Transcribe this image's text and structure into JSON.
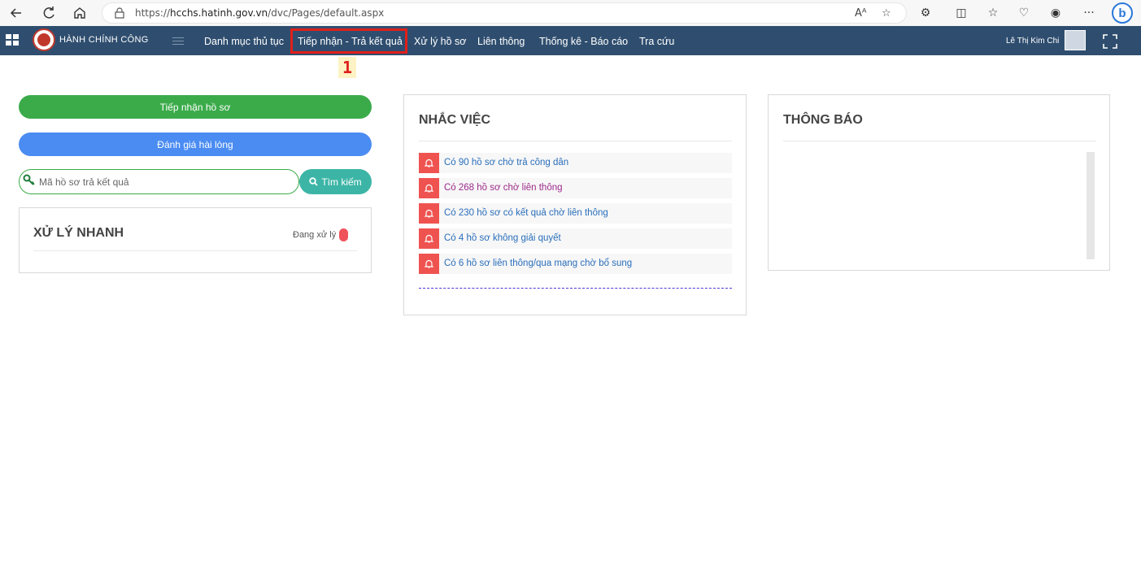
{
  "browser": {
    "url_prefix": "https://",
    "url_domain": "hcchs.hatinh.gov.vn",
    "url_path": "/dvc/Pages/default.aspx",
    "read_aloud_icon": "Aᴬ",
    "more_label": "···"
  },
  "header": {
    "brand": "HÀNH CHÍNH CÔNG",
    "menu": [
      {
        "label": "Danh mục thủ tục"
      },
      {
        "label": "Tiếp nhận - Trả kết quả"
      },
      {
        "label": "Xử lý hồ sơ"
      },
      {
        "label": "Liên thông"
      },
      {
        "label": "Thống kê - Báo cáo"
      },
      {
        "label": "Tra cứu"
      }
    ],
    "user_name": "Lê Thị Kim Chi",
    "highlight_color": "#e0201b"
  },
  "annotation": {
    "step": "1"
  },
  "left": {
    "receive_button": "Tiếp nhận hồ sơ",
    "rating_button": "Đánh giá hài lòng",
    "search_placeholder": "Mã hồ sơ trả kết quả",
    "search_button": "Tìm kiếm",
    "quick_title": "XỬ LÝ NHANH",
    "quick_status": "Đang xử lý"
  },
  "remind": {
    "title": "NHẮC VIỆC",
    "items": [
      {
        "text": "Có 90 hồ sơ chờ trả công dân"
      },
      {
        "text": "Có 268 hồ sơ chờ liên thông"
      },
      {
        "text": "Có 230 hồ sơ có kết quả chờ liên thông"
      },
      {
        "text": "Có 4 hồ sơ không giải quyết"
      },
      {
        "text": "Có 6 hồ sơ liên thông/qua mạng chờ bổ sung"
      }
    ]
  },
  "notice": {
    "title": "THÔNG BÁO"
  },
  "colors": {
    "header_bg": "#2f4e6f",
    "green": "#3bab4a",
    "blue": "#4a8cf2",
    "teal": "#3cb5a6",
    "bell_red": "#ef5350"
  }
}
